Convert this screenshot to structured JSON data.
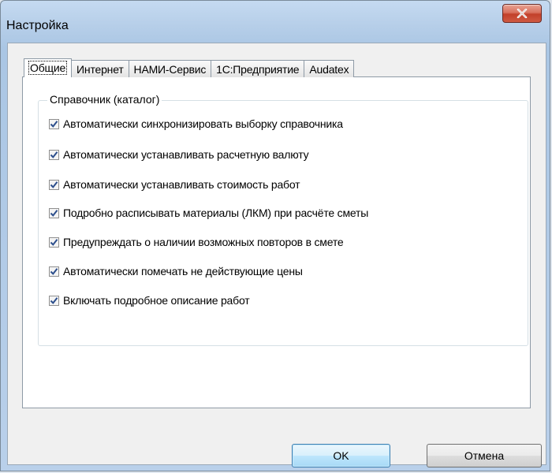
{
  "window": {
    "title": "Настройка"
  },
  "tabs": [
    {
      "label": "Общие",
      "active": true
    },
    {
      "label": "Интернет",
      "active": false
    },
    {
      "label": "НАМИ-Сервис",
      "active": false
    },
    {
      "label": "1С:Предприятие",
      "active": false
    },
    {
      "label": "Audatex",
      "active": false
    }
  ],
  "group": {
    "label": "Справочник (каталог)",
    "options": [
      {
        "label": "Автоматически синхронизировать выборку справочника",
        "checked": true
      },
      {
        "label": "Автоматически устанавливать расчетную валюту",
        "checked": true
      },
      {
        "label": "Автоматически устанавливать стоимость работ",
        "checked": true
      },
      {
        "label": "Подробно расписывать материалы (ЛКМ) при расчёте сметы",
        "checked": true
      },
      {
        "label": "Предупреждать о наличии возможных повторов в смете",
        "checked": true
      },
      {
        "label": "Автоматически помечать не действующие цены",
        "checked": true
      },
      {
        "label": "Включать подробное описание работ",
        "checked": true
      }
    ]
  },
  "buttons": {
    "ok": "OK",
    "cancel": "Отмена"
  },
  "colors": {
    "checkmark": "#2c4e8c",
    "close_button": "#c7503a",
    "default_button_border": "#3c7fb1"
  }
}
